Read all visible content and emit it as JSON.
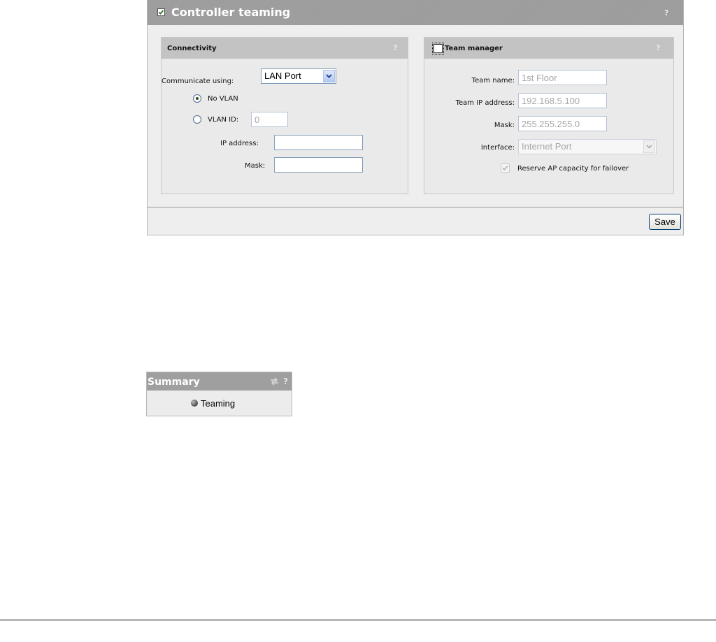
{
  "header": {
    "title": "Controller teaming",
    "help": "?",
    "enabled": true
  },
  "connectivity": {
    "title": "Connectivity",
    "help": "?",
    "communicate_label": "Communicate using:",
    "communicate_value": "LAN Port",
    "no_vlan_label": "No VLAN",
    "vlan_id_label": "VLAN ID:",
    "vlan_id_value": "0",
    "selected": "No VLAN",
    "ip_label": "IP address:",
    "ip_value": "",
    "mask_label": "Mask:",
    "mask_value": ""
  },
  "team_manager": {
    "title": "Team manager",
    "help": "?",
    "checked": false,
    "team_name_label": "Team name:",
    "team_name_value": "1st Floor",
    "team_ip_label": "Team IP address:",
    "team_ip_value": "192.168.5.100",
    "mask_label": "Mask:",
    "mask_value": "255.255.255.0",
    "interface_label": "Interface:",
    "interface_value": "Internet Port",
    "reserve_label": "Reserve AP capacity for failover",
    "reserve_checked": true
  },
  "footer": {
    "save_label": "Save"
  },
  "summary": {
    "title": "Summary",
    "help": "?",
    "items": [
      {
        "label": "Teaming",
        "icon": "status-gray-icon"
      }
    ]
  }
}
